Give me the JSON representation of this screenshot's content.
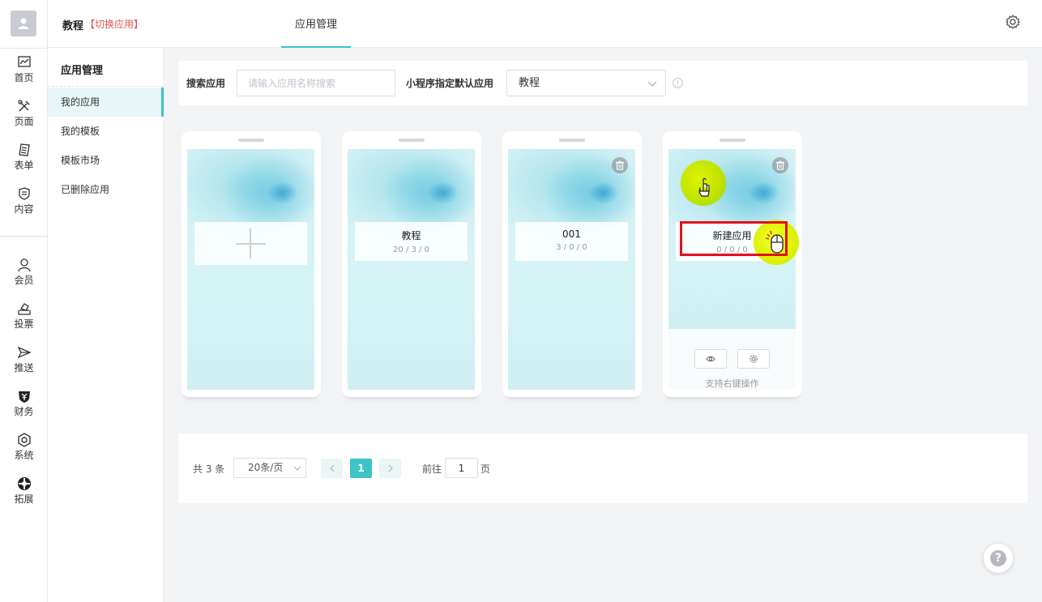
{
  "header": {
    "app_name": "教程",
    "switch_label": "【切换应用】",
    "tab_label": "应用管理"
  },
  "rail": {
    "items": [
      {
        "label": "首页",
        "icon": "chart-icon"
      },
      {
        "label": "页面",
        "icon": "tools-icon"
      },
      {
        "label": "表单",
        "icon": "form-icon"
      },
      {
        "label": "内容",
        "icon": "content-icon"
      },
      {
        "label": "会员",
        "icon": "user-icon"
      },
      {
        "label": "投票",
        "icon": "vote-icon"
      },
      {
        "label": "推送",
        "icon": "send-icon"
      },
      {
        "label": "财务",
        "icon": "yen-icon"
      },
      {
        "label": "系统",
        "icon": "system-icon"
      },
      {
        "label": "拓展",
        "icon": "extend-icon"
      }
    ]
  },
  "subnav": {
    "title": "应用管理",
    "items": [
      {
        "label": "我的应用",
        "active": true
      },
      {
        "label": "我的模板",
        "active": false
      },
      {
        "label": "模板市场",
        "active": false
      },
      {
        "label": "已删除应用",
        "active": false
      }
    ]
  },
  "search": {
    "label": "搜索应用",
    "placeholder": "请输入应用名称搜索",
    "default_label": "小程序指定默认应用",
    "default_value": "教程"
  },
  "apps": [
    {
      "name": "教程",
      "stats": "20 / 3 / 0"
    },
    {
      "name": "001",
      "stats": "3 / 0 / 0"
    },
    {
      "name": "新建应用",
      "stats": "0 / 0 / 0"
    }
  ],
  "card_actions": {
    "hint": "支持右键操作"
  },
  "pager": {
    "total": "共 3 条",
    "page_size": "20条/页",
    "current_page": "1",
    "goto_label": "前往",
    "goto_value": "1",
    "page_unit": "页"
  },
  "help_label": "?",
  "colors": {
    "accent": "#3cc4c6",
    "switch": "#e0554d",
    "highlight": "#e3101a"
  }
}
